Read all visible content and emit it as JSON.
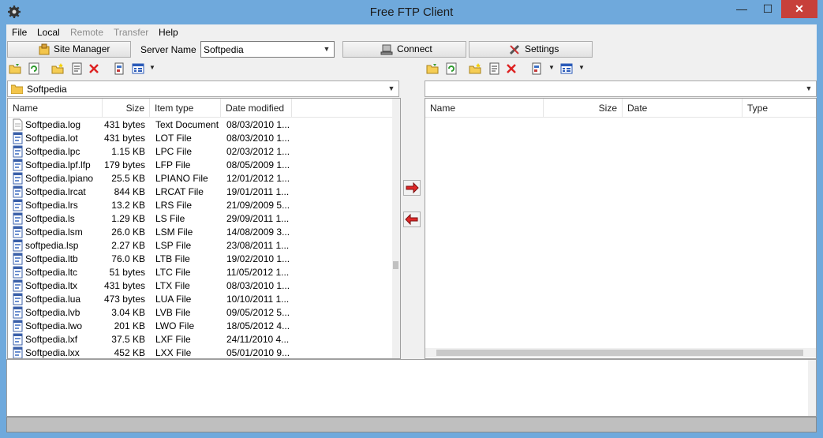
{
  "window": {
    "title": "Free FTP Client",
    "minimize": "—",
    "maximize": "☐",
    "close": "✕"
  },
  "menu": [
    {
      "label": "File",
      "disabled": false
    },
    {
      "label": "Local",
      "disabled": false
    },
    {
      "label": "Remote",
      "disabled": true
    },
    {
      "label": "Transfer",
      "disabled": true
    },
    {
      "label": "Help",
      "disabled": false
    }
  ],
  "toolbar": {
    "site_manager": "Site Manager",
    "server_name_label": "Server Name",
    "server_name_value": "Softpedia",
    "connect": "Connect",
    "settings": "Settings"
  },
  "local": {
    "path": "Softpedia",
    "columns": {
      "name": "Name",
      "size": "Size",
      "type": "Item type",
      "date": "Date modified"
    },
    "files": [
      {
        "name": "Softpedia.log",
        "size": "431 bytes",
        "type": "Text Document",
        "date": "08/03/2010 1...",
        "icon": "text"
      },
      {
        "name": "Softpedia.lot",
        "size": "431 bytes",
        "type": "LOT File",
        "date": "08/03/2010 1...",
        "icon": "app"
      },
      {
        "name": "Softpedia.lpc",
        "size": "1.15 KB",
        "type": "LPC File",
        "date": "02/03/2012 1...",
        "icon": "app"
      },
      {
        "name": "Softpedia.lpf.lfp",
        "size": "179 bytes",
        "type": "LFP File",
        "date": "08/05/2009 1...",
        "icon": "app"
      },
      {
        "name": "Softpedia.lpiano",
        "size": "25.5 KB",
        "type": "LPIANO File",
        "date": "12/01/2012 1...",
        "icon": "app"
      },
      {
        "name": "Softpedia.lrcat",
        "size": "844 KB",
        "type": "LRCAT File",
        "date": "19/01/2011 1...",
        "icon": "app"
      },
      {
        "name": "Softpedia.lrs",
        "size": "13.2 KB",
        "type": "LRS File",
        "date": "21/09/2009 5...",
        "icon": "app"
      },
      {
        "name": "Softpedia.ls",
        "size": "1.29 KB",
        "type": "LS File",
        "date": "29/09/2011 1...",
        "icon": "app"
      },
      {
        "name": "Softpedia.lsm",
        "size": "26.0 KB",
        "type": "LSM File",
        "date": "14/08/2009 3...",
        "icon": "app"
      },
      {
        "name": "softpedia.lsp",
        "size": "2.27 KB",
        "type": "LSP File",
        "date": "23/08/2011 1...",
        "icon": "app"
      },
      {
        "name": "Softpedia.ltb",
        "size": "76.0 KB",
        "type": "LTB File",
        "date": "19/02/2010 1...",
        "icon": "app"
      },
      {
        "name": "Softpedia.ltc",
        "size": "51 bytes",
        "type": "LTC File",
        "date": "11/05/2012 1...",
        "icon": "app"
      },
      {
        "name": "Softpedia.ltx",
        "size": "431 bytes",
        "type": "LTX File",
        "date": "08/03/2010 1...",
        "icon": "app"
      },
      {
        "name": "Softpedia.lua",
        "size": "473 bytes",
        "type": "LUA File",
        "date": "10/10/2011 1...",
        "icon": "app"
      },
      {
        "name": "Softpedia.lvb",
        "size": "3.04 KB",
        "type": "LVB File",
        "date": "09/05/2012 5...",
        "icon": "app"
      },
      {
        "name": "Softpedia.lwo",
        "size": "201 KB",
        "type": "LWO File",
        "date": "18/05/2012 4...",
        "icon": "app"
      },
      {
        "name": "Softpedia.lxf",
        "size": "37.5 KB",
        "type": "LXF File",
        "date": "24/11/2010 4...",
        "icon": "app"
      },
      {
        "name": "Softpedia.lxx",
        "size": "452 KB",
        "type": "LXX File",
        "date": "05/01/2010 9...",
        "icon": "app"
      }
    ]
  },
  "remote": {
    "path": "",
    "columns": {
      "name": "Name",
      "size": "Size",
      "date": "Date",
      "type": "Type"
    }
  },
  "colors": {
    "titlebar": "#6fa9dc",
    "close": "#c7403a",
    "face": "#f0f0f0",
    "status": "#bfbfbf"
  }
}
